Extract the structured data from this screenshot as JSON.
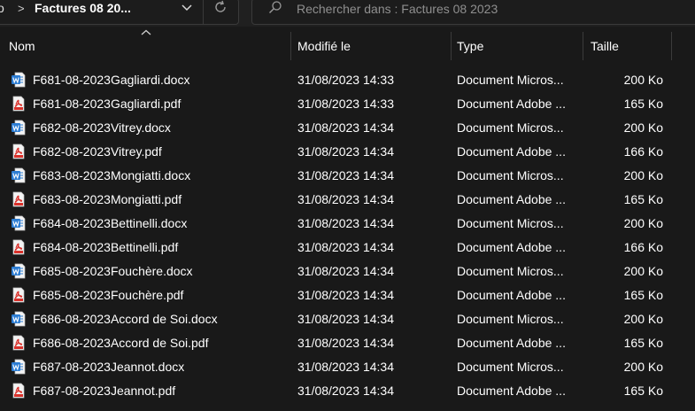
{
  "address": {
    "prev_crumb": "o",
    "separator": ">",
    "current": "Factures 08 20..."
  },
  "search": {
    "placeholder": "Rechercher dans : Factures 08 2023"
  },
  "columns": {
    "name": "Nom",
    "modified": "Modifié le",
    "type": "Type",
    "size": "Taille"
  },
  "colors": {
    "background": "#191919",
    "text": "#ffffff",
    "word_blue": "#2b7cd3",
    "pdf_red": "#d9312b"
  },
  "files": [
    {
      "name": "F681-08-2023Gagliardi.docx",
      "modified": "31/08/2023 14:33",
      "type": "Document Micros...",
      "size": "200 Ko",
      "icon": "word-doc-icon"
    },
    {
      "name": "F681-08-2023Gagliardi.pdf",
      "modified": "31/08/2023 14:33",
      "type": "Document Adobe ...",
      "size": "165 Ko",
      "icon": "pdf-doc-icon"
    },
    {
      "name": "F682-08-2023Vitrey.docx",
      "modified": "31/08/2023 14:34",
      "type": "Document Micros...",
      "size": "200 Ko",
      "icon": "word-doc-icon"
    },
    {
      "name": "F682-08-2023Vitrey.pdf",
      "modified": "31/08/2023 14:34",
      "type": "Document Adobe ...",
      "size": "166 Ko",
      "icon": "pdf-doc-icon"
    },
    {
      "name": "F683-08-2023Mongiatti.docx",
      "modified": "31/08/2023 14:34",
      "type": "Document Micros...",
      "size": "200 Ko",
      "icon": "word-doc-icon"
    },
    {
      "name": "F683-08-2023Mongiatti.pdf",
      "modified": "31/08/2023 14:34",
      "type": "Document Adobe ...",
      "size": "165 Ko",
      "icon": "pdf-doc-icon"
    },
    {
      "name": "F684-08-2023Bettinelli.docx",
      "modified": "31/08/2023 14:34",
      "type": "Document Micros...",
      "size": "200 Ko",
      "icon": "word-doc-icon"
    },
    {
      "name": "F684-08-2023Bettinelli.pdf",
      "modified": "31/08/2023 14:34",
      "type": "Document Adobe ...",
      "size": "166 Ko",
      "icon": "pdf-doc-icon"
    },
    {
      "name": "F685-08-2023Fouchère.docx",
      "modified": "31/08/2023 14:34",
      "type": "Document Micros...",
      "size": "200 Ko",
      "icon": "word-doc-icon"
    },
    {
      "name": "F685-08-2023Fouchère.pdf",
      "modified": "31/08/2023 14:34",
      "type": "Document Adobe ...",
      "size": "165 Ko",
      "icon": "pdf-doc-icon"
    },
    {
      "name": "F686-08-2023Accord de Soi.docx",
      "modified": "31/08/2023 14:34",
      "type": "Document Micros...",
      "size": "200 Ko",
      "icon": "word-doc-icon"
    },
    {
      "name": "F686-08-2023Accord de Soi.pdf",
      "modified": "31/08/2023 14:34",
      "type": "Document Adobe ...",
      "size": "165 Ko",
      "icon": "pdf-doc-icon"
    },
    {
      "name": "F687-08-2023Jeannot.docx",
      "modified": "31/08/2023 14:34",
      "type": "Document Micros...",
      "size": "200 Ko",
      "icon": "word-doc-icon"
    },
    {
      "name": "F687-08-2023Jeannot.pdf",
      "modified": "31/08/2023 14:34",
      "type": "Document Adobe ...",
      "size": "165 Ko",
      "icon": "pdf-doc-icon"
    }
  ]
}
